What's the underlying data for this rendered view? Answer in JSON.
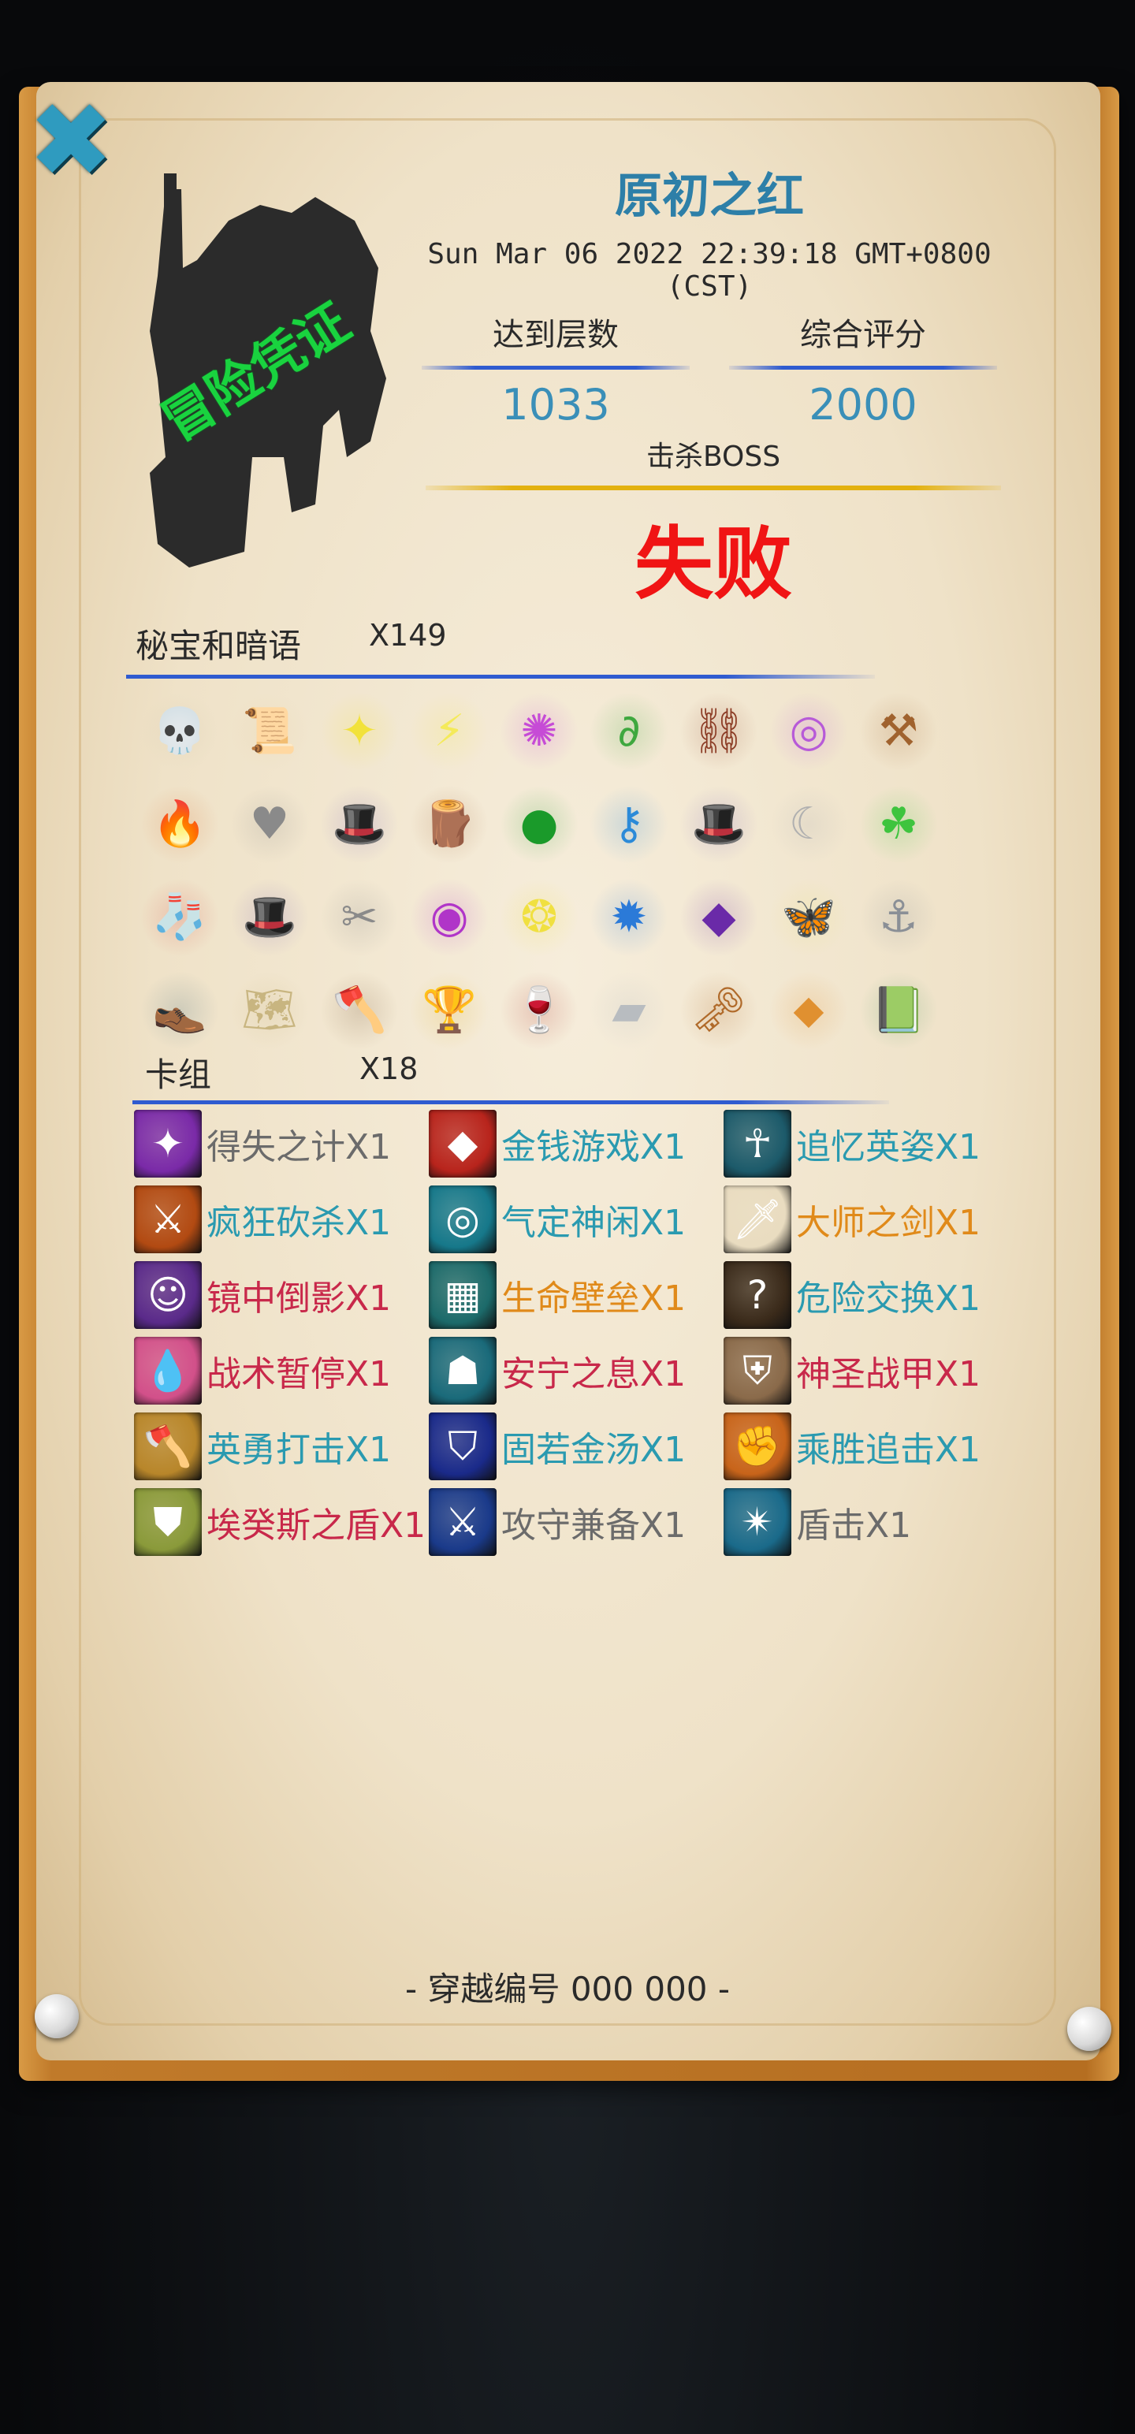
{
  "header": {
    "title": "原初之红",
    "timestamp": "Sun Mar 06 2022 22:39:18 GMT+0800 (CST)",
    "stamp": "冒险凭证"
  },
  "stats": {
    "floor_label": "达到层数",
    "floor_value": "1033",
    "score_label": "综合评分",
    "score_value": "2000",
    "boss_label": "击杀BOSS",
    "result": "失败"
  },
  "treasures": {
    "label": "秘宝和暗语",
    "count": "X149",
    "items": [
      {
        "icon": "skull-icon",
        "glyph": "💀",
        "color": "#cfc4a8"
      },
      {
        "icon": "scroll-icon",
        "glyph": "📜",
        "color": "#e3cfa2"
      },
      {
        "icon": "yellow-rune-icon",
        "glyph": "✦",
        "color": "#f2e23a"
      },
      {
        "icon": "yellow-claw-rune-icon",
        "glyph": "⚡",
        "color": "#f4ea5a"
      },
      {
        "icon": "purple-rune-icon",
        "glyph": "✺",
        "color": "#c64bd6"
      },
      {
        "icon": "green-rune-icon",
        "glyph": "∂",
        "color": "#3fa83f"
      },
      {
        "icon": "chain-icon",
        "glyph": "⛓",
        "color": "#8b3b24"
      },
      {
        "icon": "purple-swirl-icon",
        "glyph": "◎",
        "color": "#b75ad8"
      },
      {
        "icon": "shovel-icon",
        "glyph": "⚒",
        "color": "#a0622e"
      },
      {
        "icon": "fire-pot-icon",
        "glyph": "🔥",
        "color": "#d86a2a"
      },
      {
        "icon": "stone-heart-icon",
        "glyph": "♥",
        "color": "#8a8a8a"
      },
      {
        "icon": "wizard-hat-icon",
        "glyph": "🎩",
        "color": "#6f54b8"
      },
      {
        "icon": "log-icon",
        "glyph": "🪵",
        "color": "#9a5a30"
      },
      {
        "icon": "green-orb-icon",
        "glyph": "●",
        "color": "#1a9a2a"
      },
      {
        "icon": "blue-rune-icon",
        "glyph": "⚷",
        "color": "#2b8ad8"
      },
      {
        "icon": "wizard-hat-icon",
        "glyph": "🎩",
        "color": "#6f54b8"
      },
      {
        "icon": "crescent-blade-icon",
        "glyph": "☾",
        "color": "#b0b0b0"
      },
      {
        "icon": "clover-icon",
        "glyph": "☘",
        "color": "#3ec43e"
      },
      {
        "icon": "stocking-icon",
        "glyph": "🧦",
        "color": "#d23c3c"
      },
      {
        "icon": "wizard-hat-icon",
        "glyph": "🎩",
        "color": "#6f54b8"
      },
      {
        "icon": "pliers-icon",
        "glyph": "✂",
        "color": "#8a8a8a"
      },
      {
        "icon": "purple-eye-rune-icon",
        "glyph": "◉",
        "color": "#b035c8"
      },
      {
        "icon": "yellow-swirl-rune-icon",
        "glyph": "❂",
        "color": "#f0e040"
      },
      {
        "icon": "blue-claw-rune-icon",
        "glyph": "✹",
        "color": "#2b7ad8"
      },
      {
        "icon": "purple-gem-icon",
        "glyph": "◆",
        "color": "#6a2aa8"
      },
      {
        "icon": "butterfly-icon",
        "glyph": "🦋",
        "color": "#e8e070"
      },
      {
        "icon": "anchor-icon",
        "glyph": "⚓",
        "color": "#8a8f96"
      },
      {
        "icon": "shoe-icon",
        "glyph": "👞",
        "color": "#4a7080"
      },
      {
        "icon": "map-scroll-icon",
        "glyph": "🗺",
        "color": "#c8b580"
      },
      {
        "icon": "axe-icon",
        "glyph": "🪓",
        "color": "#7a5a3a"
      },
      {
        "icon": "golden-cup-icon",
        "glyph": "🏆",
        "color": "#e0b020"
      },
      {
        "icon": "wine-glass-icon",
        "glyph": "🍷",
        "color": "#b03030"
      },
      {
        "icon": "silver-ingot-icon",
        "glyph": "▰",
        "color": "#b8bcc0"
      },
      {
        "icon": "key-icon",
        "glyph": "🗝",
        "color": "#b06a2a"
      },
      {
        "icon": "amulet-icon",
        "glyph": "⬥",
        "color": "#e09030"
      },
      {
        "icon": "green-book-icon",
        "glyph": "📗",
        "color": "#2a8a4a"
      }
    ]
  },
  "deck": {
    "label": "卡组",
    "count": "X18",
    "cards": [
      {
        "name": "得失之计X1",
        "color": "#6b6b6b",
        "icon": "purple-burst-icon",
        "glyph": "✦",
        "bg": "#7a2aa8"
      },
      {
        "name": "金钱游戏X1",
        "color": "#2a9ab0",
        "icon": "red-gem-icon",
        "glyph": "◆",
        "bg": "#b8241c"
      },
      {
        "name": "追忆英姿X1",
        "color": "#2a9ab0",
        "icon": "spirit-warrior-icon",
        "glyph": "☥",
        "bg": "#1c5a6a"
      },
      {
        "name": "疯狂砍杀X1",
        "color": "#2a9ab0",
        "icon": "fire-slash-icon",
        "glyph": "⚔",
        "bg": "#b24a12"
      },
      {
        "name": "气定神闲X1",
        "color": "#2a9ab0",
        "icon": "blue-vortex-icon",
        "glyph": "◎",
        "bg": "#16788a"
      },
      {
        "name": "大师之剑X1",
        "color": "#e08a1a",
        "icon": "master-sword-icon",
        "glyph": "🗡",
        "bg": "#e9dcc0"
      },
      {
        "name": "镜中倒影X1",
        "color": "#c8284a",
        "icon": "purple-face-icon",
        "glyph": "☺",
        "bg": "#5a2a8a"
      },
      {
        "name": "生命壁垒X1",
        "color": "#e08a1a",
        "icon": "teal-wall-icon",
        "glyph": "▦",
        "bg": "#1c6a6a"
      },
      {
        "name": "危险交换X1",
        "color": "#2a9ab0",
        "icon": "question-mark-icon",
        "glyph": "?",
        "bg": "#3a2a1a"
      },
      {
        "name": "战术暂停X1",
        "color": "#c8284a",
        "icon": "blue-drop-icon",
        "glyph": "💧",
        "bg": "#d2508a"
      },
      {
        "name": "安宁之息X1",
        "color": "#c8284a",
        "icon": "teal-figure-icon",
        "glyph": "☗",
        "bg": "#1a6a7a"
      },
      {
        "name": "神圣战甲X1",
        "color": "#c8284a",
        "icon": "holy-armor-icon",
        "glyph": "⛨",
        "bg": "#8a6a4a"
      },
      {
        "name": "英勇打击X1",
        "color": "#2a9ab0",
        "icon": "battle-axe-icon",
        "glyph": "🪓",
        "bg": "#b8862a"
      },
      {
        "name": "固若金汤X1",
        "color": "#2a9ab0",
        "icon": "blue-shield-icon",
        "glyph": "⛉",
        "bg": "#1a2a8a"
      },
      {
        "name": "乘胜追击X1",
        "color": "#2a9ab0",
        "icon": "fist-icon",
        "glyph": "✊",
        "bg": "#c8641a"
      },
      {
        "name": "埃癸斯之盾X1",
        "color": "#c8284a",
        "icon": "aegis-shield-icon",
        "glyph": "⛊",
        "bg": "#8a9a3a"
      },
      {
        "name": "攻守兼备X1",
        "color": "#6b6b6b",
        "icon": "crossed-swords-icon",
        "glyph": "⚔",
        "bg": "#1a3a8a"
      },
      {
        "name": "盾击X1",
        "color": "#6b6b6b",
        "icon": "shield-bash-icon",
        "glyph": "✴",
        "bg": "#1a6a8a"
      }
    ]
  },
  "footer": {
    "text": "- 穿越编号 000 000 -"
  }
}
